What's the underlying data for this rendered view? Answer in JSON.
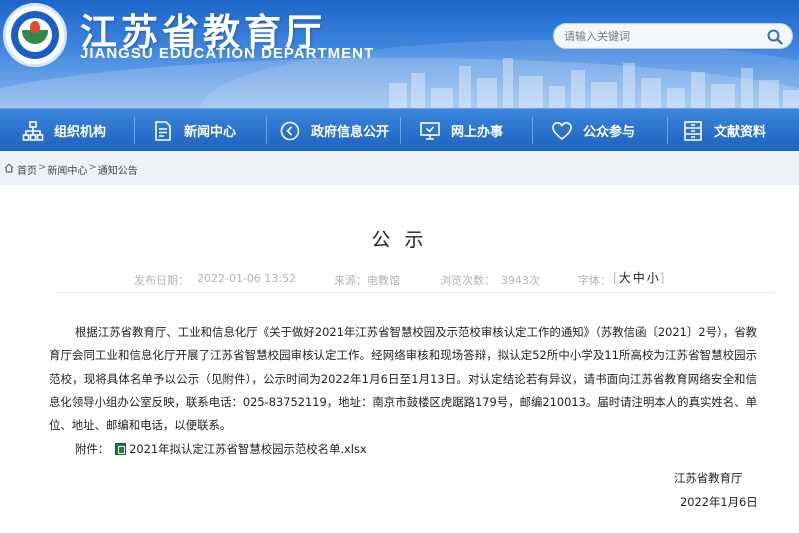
{
  "header": {
    "title_cn": "江苏省教育厅",
    "title_en": "JIANGSU EDUCATION DEPARTMENT",
    "logo_icon": "education-department-emblem"
  },
  "search": {
    "placeholder": "请输入关键词",
    "icon": "search-icon"
  },
  "nav": {
    "items": [
      {
        "label": "组织机构",
        "icon": "org-chart-icon"
      },
      {
        "label": "新闻中心",
        "icon": "news-document-icon"
      },
      {
        "label": "政府信息公开",
        "icon": "info-disclosure-icon"
      },
      {
        "label": "网上办事",
        "icon": "online-service-monitor-icon"
      },
      {
        "label": "公众参与",
        "icon": "heart-participation-icon"
      },
      {
        "label": "文献资料",
        "icon": "archive-cabinet-icon"
      }
    ]
  },
  "breadcrumb": {
    "items": [
      "首页",
      "新闻中心",
      "通知公告"
    ],
    "separator": ">"
  },
  "article": {
    "title": "公 示",
    "meta": {
      "publish_label": "发布日期：",
      "publish_date": "2022-01-06 13:52",
      "source_label": "来源：",
      "source": "电教馆",
      "views_label": "浏览次数：",
      "views": "3943次",
      "font_label": "字体：",
      "font_sizes": [
        "大",
        "中",
        "小"
      ]
    },
    "body": "根据江苏省教育厅、工业和信息化厅《关于做好2021年江苏省智慧校园及示范校审核认定工作的通知》（苏教信函〔2021〕2号），省教育厅会同工业和信息化厅开展了江苏省智慧校园审核认定工作。经网络审核和现场答辩，拟认定52所中小学及11所高校为江苏省智慧校园示范校，现将具体名单予以公示（见附件），公示时间为2022年1月6日至1月13日。对认定结论若有异议，请书面向江苏省教育网络安全和信息化领导小组办公室反映，联系电话：025-83752119，地址：南京市鼓楼区虎踞路179号，邮编210013。届时请注明本人的真实姓名、单位、地址、邮编和电话，以便联系。",
    "attachment_label": "附件：",
    "attachment_file": "2021年拟认定江苏省智慧校园示范校名单.xlsx",
    "signature_org": "江苏省教育厅",
    "signature_date": "2022年1月6日"
  },
  "colors": {
    "header_blue": "#1c66c9",
    "nav_blue": "#2a6fcb",
    "breadcrumb_bg": "#eef2f7",
    "meta_gray": "#b3b3b3"
  }
}
